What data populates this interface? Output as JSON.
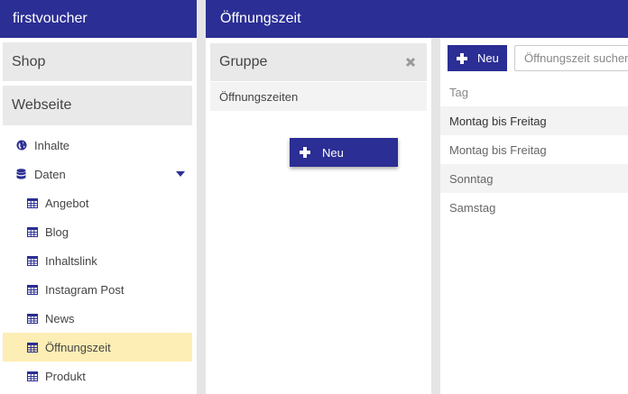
{
  "sidebar": {
    "app_title": "firstvoucher",
    "sections": [
      "Shop",
      "Webseite"
    ],
    "items": [
      {
        "label": "Inhalte",
        "icon": "globe-icon"
      },
      {
        "label": "Daten",
        "icon": "database-icon"
      }
    ],
    "sub_items": [
      {
        "label": "Angebot",
        "icon": "table-icon"
      },
      {
        "label": "Blog",
        "icon": "table-icon"
      },
      {
        "label": "Inhaltslink",
        "icon": "table-icon"
      },
      {
        "label": "Instagram Post",
        "icon": "table-icon"
      },
      {
        "label": "News",
        "icon": "table-icon"
      },
      {
        "label": "Öffnungszeit",
        "icon": "table-icon",
        "active": true
      },
      {
        "label": "Produkt",
        "icon": "table-icon"
      }
    ]
  },
  "main": {
    "title": "Öffnungszeit"
  },
  "gruppe": {
    "title": "Gruppe",
    "rows": [
      "Öffnungszeiten"
    ],
    "new_button": "Neu"
  },
  "table": {
    "new_button": "Neu",
    "search_placeholder": "Öffnungszeit suchen",
    "column_header": "Tag",
    "rows": [
      "Montag bis Freitag",
      "Montag bis Freitag",
      "Sonntag",
      "Samstag"
    ]
  },
  "colors": {
    "primary": "#2b2e94",
    "active_highlight": "#fdeeb5",
    "section_bg": "#e9e9e9"
  }
}
